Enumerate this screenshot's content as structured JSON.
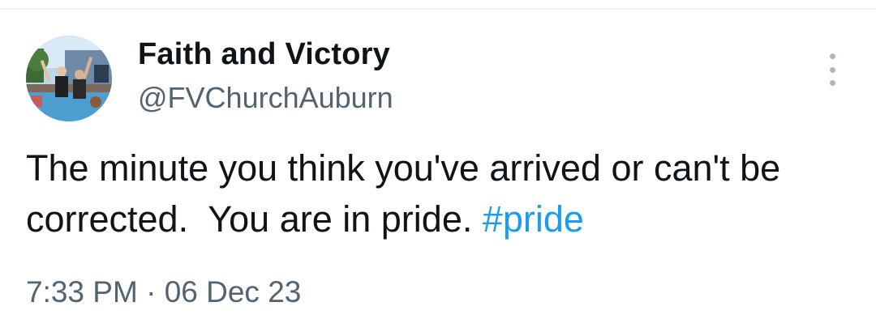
{
  "tweet": {
    "author": {
      "display_name": "Faith and Victory",
      "handle": "@FVChurchAuburn",
      "avatar_icon": "profile-photo"
    },
    "text_main": "The minute you think you've arrived or can't be corrected.  You are in pride. ",
    "hashtag": "#pride",
    "time": "7:33 PM",
    "separator": "·",
    "date": "06 Dec 23",
    "more_icon": "vertical-ellipsis-icon"
  },
  "colors": {
    "text": "#0f1419",
    "secondary": "#536471",
    "link": "#1d9bf0"
  }
}
